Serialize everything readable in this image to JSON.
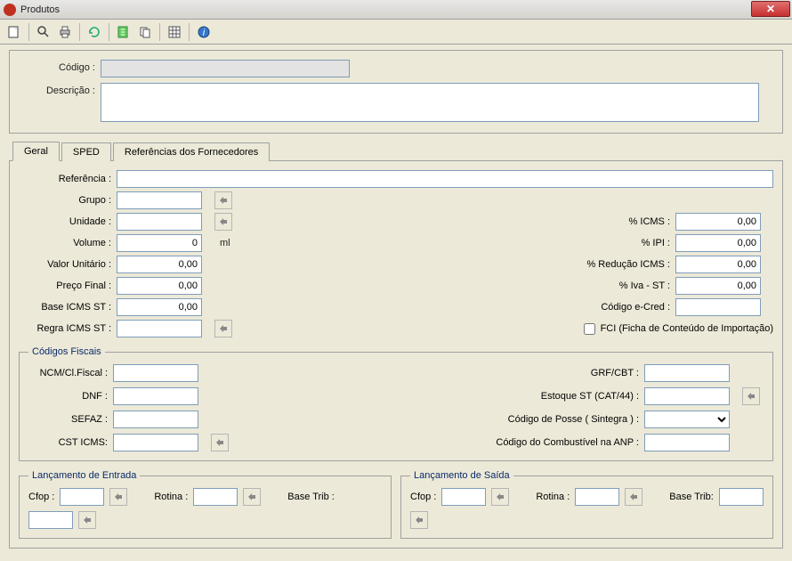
{
  "window": {
    "title": "Produtos"
  },
  "toolbar": {
    "icons": [
      "new",
      "search",
      "print",
      "refresh",
      "edit",
      "copy",
      "grid",
      "help"
    ]
  },
  "top": {
    "codigo_label": "Código :",
    "descricao_label": "Descrição :",
    "codigo_value": "",
    "descricao_value": ""
  },
  "tabs": {
    "geral": "Geral",
    "sped": "SPED",
    "ref_forn": "Referências dos Fornecedores"
  },
  "geral": {
    "referencia_label": "Referência :",
    "referencia": "",
    "grupo_label": "Grupo :",
    "grupo": "",
    "unidade_label": "Unidade :",
    "unidade": "",
    "volume_label": "Volume :",
    "volume": "0",
    "volume_suffix": "ml",
    "valor_unit_label": "Valor Unitário :",
    "valor_unit": "0,00",
    "preco_final_label": "Preço Final :",
    "preco_final": "0,00",
    "base_icms_st_label": "Base ICMS ST :",
    "base_icms_st": "0,00",
    "regra_icms_st_label": "Regra ICMS ST :",
    "regra_icms_st": "",
    "pct_icms_label": "% ICMS :",
    "pct_icms": "0,00",
    "pct_ipi_label": "% IPI :",
    "pct_ipi": "0,00",
    "pct_reducao_label": "% Redução ICMS :",
    "pct_reducao": "0,00",
    "pct_iva_st_label": "% Iva - ST :",
    "pct_iva_st": "0,00",
    "cod_ecred_label": "Código e-Cred :",
    "cod_ecred": "",
    "fci_label": "FCI (Ficha de Conteúdo de Importação)"
  },
  "codigos_fiscais": {
    "legend": "Códigos Fiscais",
    "ncm_label": "NCM/Cl.Fiscal :",
    "ncm": "",
    "dnf_label": "DNF :",
    "dnf": "",
    "sefaz_label": "SEFAZ :",
    "sefaz": "",
    "cst_icms_label": "CST ICMS:",
    "cst_icms": "",
    "grf_label": "GRF/CBT :",
    "grf": "",
    "estoque_st_label": "Estoque ST (CAT/44) :",
    "estoque_st": "",
    "cod_posse_label": "Código de Posse ( Sintegra ) :",
    "cod_posse": "",
    "cod_comb_label": "Código do Combustível na ANP :",
    "cod_comb": ""
  },
  "lanc_entrada": {
    "legend": "Lançamento de Entrada",
    "cfop_label": "Cfop :",
    "cfop": "",
    "rotina_label": "Rotina :",
    "rotina": "",
    "base_trib_label": "Base Trib :",
    "base_trib": ""
  },
  "lanc_saida": {
    "legend": "Lançamento de Saída",
    "cfop_label": "Cfop :",
    "cfop": "",
    "rotina_label": "Rotina :",
    "rotina": "",
    "base_trib_label": "Base Trib:",
    "base_trib": ""
  }
}
